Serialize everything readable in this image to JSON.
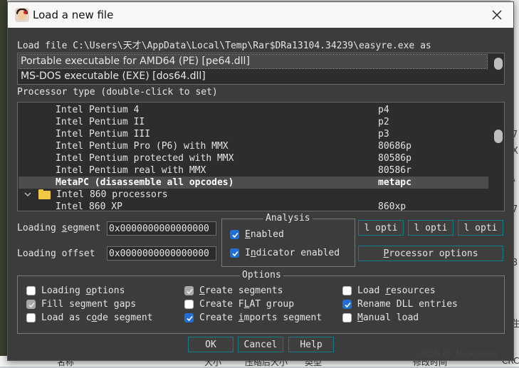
{
  "window": {
    "title": "Load a new file"
  },
  "load_file": {
    "prefix": "Load file",
    "path": "C:\\Users\\天才\\AppData\\Local\\Temp\\Rar$DRa13104.34239\\easyre.exe",
    "suffix": "as"
  },
  "formats": [
    {
      "label": "Portable executable for AMD64 (PE) [pe64.dll]",
      "selected": true
    },
    {
      "label": "MS-DOS executable (EXE) [dos64.dll]",
      "selected": false
    }
  ],
  "processor": {
    "label": "Processor type (double-click to set)",
    "rows": [
      {
        "name": "Intel Pentium 4",
        "code": "p4"
      },
      {
        "name": "Intel Pentium II",
        "code": "p2"
      },
      {
        "name": "Intel Pentium III",
        "code": "p3"
      },
      {
        "name": "Intel Pentium Pro (P6) with MMX",
        "code": "80686p"
      },
      {
        "name": "Intel Pentium protected with MMX",
        "code": "80586p"
      },
      {
        "name": "Intel Pentium real with MMX",
        "code": "80586r"
      },
      {
        "name": "MetaPC (disassemble all opcodes)",
        "code": "metapc",
        "selected": true
      },
      {
        "name": "Intel 860 processors",
        "code": "",
        "group": true
      },
      {
        "name": "Intel 860 XP",
        "code": "860xp"
      }
    ]
  },
  "loading_segment": {
    "label_pre": "Loading ",
    "label_u": "s",
    "label_post": "egment",
    "value": "0x0000000000000000"
  },
  "loading_offset": {
    "label": "Loading offset",
    "value": "0x0000000000000000"
  },
  "analysis": {
    "title": "Analysis",
    "enabled": {
      "u": "E",
      "rest": "nabled",
      "checked": true
    },
    "indicator": {
      "pre": "I",
      "u": "n",
      "rest": "dicator enabled",
      "checked": true
    }
  },
  "kernel_buttons": [
    "l opti",
    "l opti",
    "l opti"
  ],
  "processor_options": {
    "u": "P",
    "rest": "rocessor options"
  },
  "options": {
    "title": "Options",
    "items": [
      {
        "pre": "Loading ",
        "u": "o",
        "rest": "ptions",
        "checked": false,
        "disabled": false
      },
      {
        "pre": "",
        "u": "C",
        "rest": "reate segments",
        "checked": true,
        "disabled": true
      },
      {
        "pre": "Load ",
        "u": "r",
        "rest": "esources",
        "checked": false,
        "disabled": false
      },
      {
        "pre": "Fill segment gaps",
        "u": "",
        "rest": "",
        "checked": true,
        "disabled": true
      },
      {
        "pre": "Create F",
        "u": "L",
        "rest": "AT group",
        "checked": false,
        "disabled": false
      },
      {
        "pre": "Rename DLL entries",
        "u": "",
        "rest": "",
        "checked": true,
        "disabled": false
      },
      {
        "pre": "Load as c",
        "u": "o",
        "rest": "de segment",
        "checked": false,
        "disabled": false
      },
      {
        "pre": "Create ",
        "u": "i",
        "rest": "mports segment",
        "checked": true,
        "disabled": false
      },
      {
        "pre": "",
        "u": "M",
        "rest": "anual load",
        "checked": false,
        "disabled": false
      }
    ]
  },
  "buttons": {
    "ok": "OK",
    "cancel": "Cancel",
    "help": "Help"
  },
  "background": {
    "right_glyphs": [
      "7",
      "X",
      "\\",
      "7",
      "3",
      "I",
      "生"
    ],
    "bottom_labels": [
      "名称",
      "大小",
      "压缩后大小",
      "类型",
      "修改时间",
      "CRC"
    ]
  },
  "watermark": "CSDN @_Nickname",
  "colors": {
    "accent_border": "#0f7d86",
    "check_blue": "#1f6fd6",
    "dialog_bg": "#3c3c3c"
  }
}
